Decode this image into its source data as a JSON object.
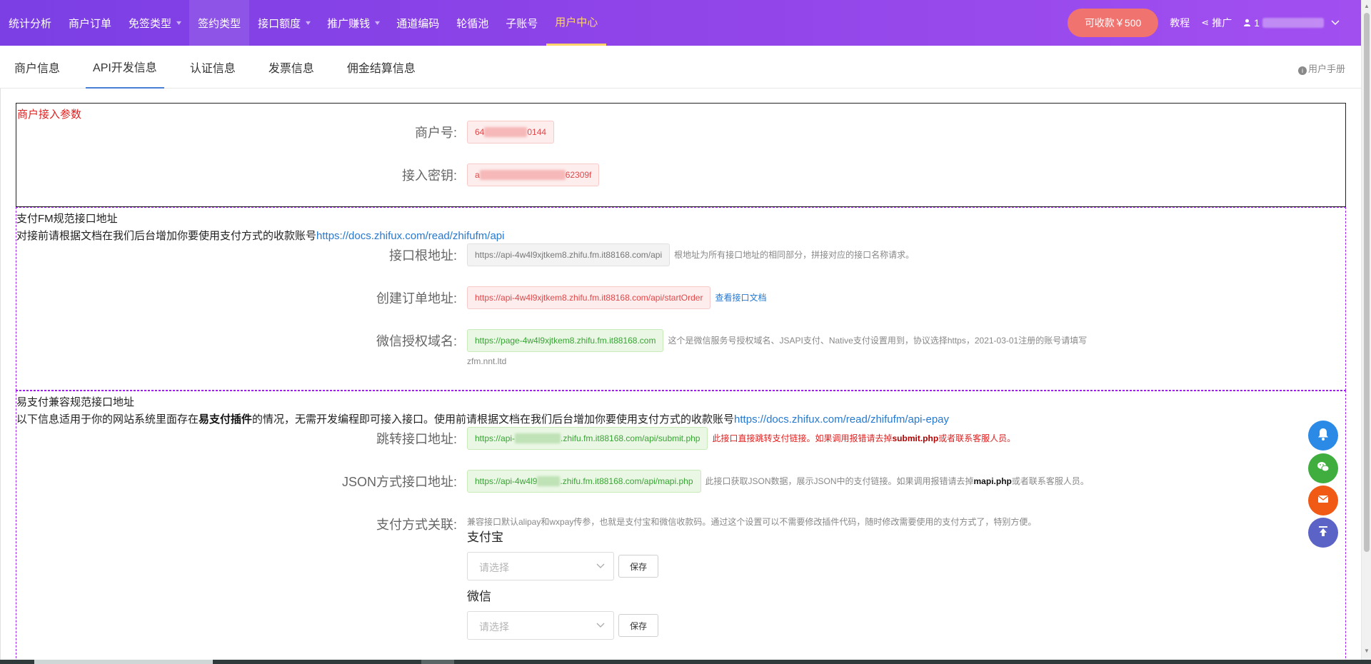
{
  "topnav": {
    "items": [
      {
        "label": "统计分析",
        "has_caret": false
      },
      {
        "label": "商户订单",
        "has_caret": false
      },
      {
        "label": "免签类型",
        "has_caret": true
      },
      {
        "label": "签约类型",
        "has_caret": false
      },
      {
        "label": "接口额度",
        "has_caret": true
      },
      {
        "label": "推广赚钱",
        "has_caret": true
      },
      {
        "label": "通道编码",
        "has_caret": false
      },
      {
        "label": "轮循池",
        "has_caret": false
      },
      {
        "label": "子账号",
        "has_caret": false
      },
      {
        "label": "用户中心",
        "has_caret": false
      }
    ],
    "active_item": "用户中心",
    "collect_button": "可收款￥500",
    "tutorial": "教程",
    "promote": "推广",
    "user_prefix": "1",
    "colors": {
      "bar_start": "#7b3fe4",
      "bar_end": "#a24ff0",
      "active": "#ffd36b",
      "collect_bg": "#f0736f"
    }
  },
  "tabs": {
    "items": [
      "商户信息",
      "API开发信息",
      "认证信息",
      "发票信息",
      "佣金结算信息"
    ],
    "active": "API开发信息",
    "manual": "用户手册"
  },
  "merchant_params": {
    "title": "商户接入参数",
    "merchant_no_label": "商户号:",
    "merchant_no_prefix": "64",
    "merchant_no_suffix": "0144",
    "secret_label": "接入密钥:",
    "secret_prefix": "a",
    "secret_suffix": "62309f"
  },
  "fm_section": {
    "title": "支付FM规范接口地址",
    "desc": "对接前请根据文档在我们后台增加你要使用支付方式的收款账号",
    "desc_link": "https://docs.zhifux.com/read/zhifufm/api",
    "root_label": "接口根地址:",
    "root_value": "https://api-4w4l9xjtkem8.zhifu.fm.it88168.com/api",
    "root_note": "根地址为所有接口地址的相同部分，拼接对应的接口名称请求。",
    "create_label": "创建订单地址:",
    "create_value": "https://api-4w4l9xjtkem8.zhifu.fm.it88168.com/api/startOrder",
    "create_link": "查看接口文档",
    "wechat_label": "微信授权域名:",
    "wechat_value": "https://page-4w4l9xjtkem8.zhifu.fm.it88168.com",
    "wechat_note": "这个是微信服务号授权域名、JSAPI支付、Native支付设置用到，协议选择https，2021-03-01注册的账号请填写",
    "wechat_note2": "zfm.nnt.ltd"
  },
  "epay_section": {
    "title": "易支付兼容规范接口地址",
    "desc_before": "以下信息适用于你的网站系统里面存在",
    "desc_bold": "易支付插件",
    "desc_after": "的情况，无需开发编程即可接入接口。使用前请根据文档在我们后台增加你要使用支付方式的收款账号",
    "desc_link": "https://docs.zhifux.com/read/zhifufm/api-epay",
    "jump_label": "跳转接口地址:",
    "jump_prefix": "https://api-",
    "jump_suffix": ".zhifu.fm.it88168.com/api/submit.php",
    "jump_note_before": "此接口直接跳转支付链接。如果调用报错请去掉",
    "jump_note_bold": "submit.php",
    "jump_note_after": "或者联系客服人员。",
    "json_label": "JSON方式接口地址:",
    "json_prefix": "https://api-4w4l9",
    "json_suffix": ".zhifu.fm.it88168.com/api/mapi.php",
    "json_note_before": "此接口获取JSON数据，展示JSON中的支付链接。如果调用报错请去掉",
    "json_note_bold": "mapi.php",
    "json_note_after": "或者联系客服人员。",
    "paymap_label": "支付方式关联:",
    "paymap_desc": "兼容接口默认alipay和wxpay传参，也就是支付宝和微信收款码。通过这个设置可以不需要修改插件代码，随时修改需要使用的支付方式了，特别方便。",
    "alipay_title": "支付宝",
    "wechat_title": "微信",
    "select_placeholder": "请选择",
    "save_label": "保存"
  },
  "floating": {
    "bell_color": "#2b8ae6",
    "wechat_color": "#3fae3f",
    "mail_color": "#f05a14",
    "top_color": "#5b63c6"
  }
}
